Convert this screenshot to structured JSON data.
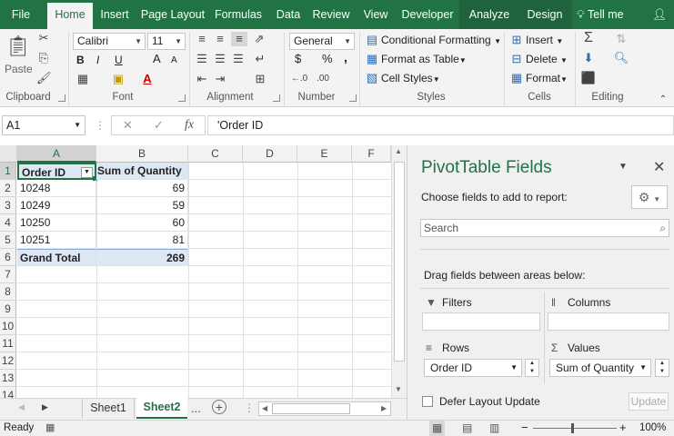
{
  "tabs": [
    "File",
    "Home",
    "Insert",
    "Page Layout",
    "Formulas",
    "Data",
    "Review",
    "View",
    "Developer",
    "Analyze",
    "Design"
  ],
  "tell_me": "Tell me",
  "clipboard": {
    "paste": "Paste",
    "label": "Clipboard"
  },
  "font": {
    "name": "Calibri",
    "size": "11",
    "label": "Font",
    "bold": "B",
    "italic": "I",
    "underline": "U",
    "grow": "A",
    "shrink": "A"
  },
  "alignment": {
    "label": "Alignment"
  },
  "number": {
    "format": "General",
    "currency": "$",
    "percent": "%",
    "comma": ",",
    "inc_dec": "←.0",
    ".00": ".00",
    "label": "Number"
  },
  "styles": {
    "conditional": "Conditional Formatting",
    "table": "Format as Table",
    "cell_styles": "Cell Styles",
    "label": "Styles"
  },
  "cells": {
    "insert": "Insert",
    "delete": "Delete",
    "format": "Format",
    "label": "Cells"
  },
  "editing": {
    "label": "Editing"
  },
  "formula_bar": {
    "name_box": "A1",
    "value": "'Order ID",
    "cancel": "✕",
    "enter": "✓",
    "fx": "fx"
  },
  "columns": [
    "A",
    "B",
    "C",
    "D",
    "E",
    "F"
  ],
  "rows": [
    "1",
    "2",
    "3",
    "4",
    "5",
    "6",
    "7",
    "8",
    "9",
    "10",
    "11",
    "12",
    "13",
    "14"
  ],
  "table": {
    "header": [
      "Order ID",
      "Sum of Quantity"
    ],
    "data": [
      [
        "10248",
        "69"
      ],
      [
        "10249",
        "59"
      ],
      [
        "10250",
        "60"
      ],
      [
        "10251",
        "81"
      ]
    ],
    "total": [
      "Grand Total",
      "269"
    ]
  },
  "sheets": {
    "tabs": [
      "Sheet1",
      "Sheet2"
    ],
    "active": "Sheet2",
    "more": "..."
  },
  "pivot": {
    "title": "PivotTable Fields",
    "choose": "Choose fields to add to report:",
    "search": "Search",
    "drag": "Drag fields between areas below:",
    "filters": "Filters",
    "columns": "Columns",
    "rows": "Rows",
    "values": "Values",
    "row_field": "Order ID",
    "value_field": "Sum of Quantity",
    "defer": "Defer Layout Update",
    "update": "Update"
  },
  "status": {
    "ready": "Ready",
    "zoom": "100%",
    "minus": "−",
    "plus": "+"
  }
}
